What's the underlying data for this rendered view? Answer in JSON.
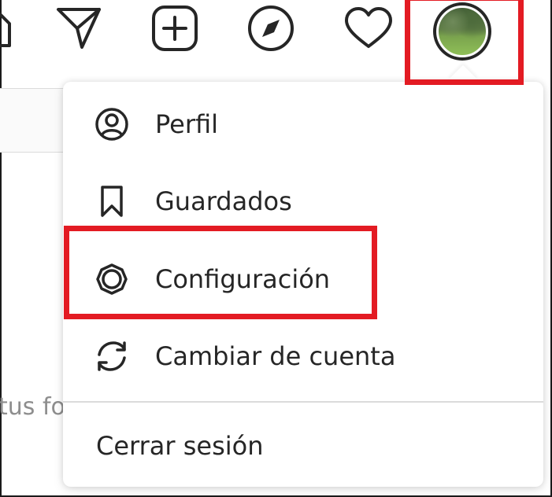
{
  "nav": {
    "icons": [
      "home-icon",
      "direct-messages-icon",
      "new-post-icon",
      "explore-icon",
      "activity-heart-icon",
      "profile-avatar"
    ]
  },
  "background": {
    "partial_text": "tus fo"
  },
  "menu": {
    "items": [
      {
        "label": "Perfil",
        "icon": "profile-icon"
      },
      {
        "label": "Guardados",
        "icon": "bookmark-icon"
      },
      {
        "label": "Configuración",
        "icon": "settings-gear-icon"
      },
      {
        "label": "Cambiar de cuenta",
        "icon": "switch-account-icon"
      }
    ],
    "logout_label": "Cerrar sesión"
  },
  "colors": {
    "highlight": "#e31b23",
    "text": "#262626",
    "divider": "#dbdbdb"
  }
}
